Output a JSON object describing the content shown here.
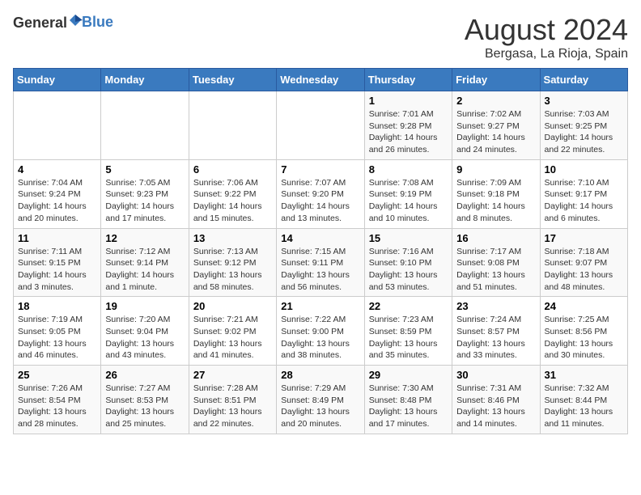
{
  "header": {
    "logo_general": "General",
    "logo_blue": "Blue",
    "month_year": "August 2024",
    "location": "Bergasa, La Rioja, Spain"
  },
  "weekdays": [
    "Sunday",
    "Monday",
    "Tuesday",
    "Wednesday",
    "Thursday",
    "Friday",
    "Saturday"
  ],
  "weeks": [
    [
      {
        "day": "",
        "info": ""
      },
      {
        "day": "",
        "info": ""
      },
      {
        "day": "",
        "info": ""
      },
      {
        "day": "",
        "info": ""
      },
      {
        "day": "1",
        "info": "Sunrise: 7:01 AM\nSunset: 9:28 PM\nDaylight: 14 hours\nand 26 minutes."
      },
      {
        "day": "2",
        "info": "Sunrise: 7:02 AM\nSunset: 9:27 PM\nDaylight: 14 hours\nand 24 minutes."
      },
      {
        "day": "3",
        "info": "Sunrise: 7:03 AM\nSunset: 9:25 PM\nDaylight: 14 hours\nand 22 minutes."
      }
    ],
    [
      {
        "day": "4",
        "info": "Sunrise: 7:04 AM\nSunset: 9:24 PM\nDaylight: 14 hours\nand 20 minutes."
      },
      {
        "day": "5",
        "info": "Sunrise: 7:05 AM\nSunset: 9:23 PM\nDaylight: 14 hours\nand 17 minutes."
      },
      {
        "day": "6",
        "info": "Sunrise: 7:06 AM\nSunset: 9:22 PM\nDaylight: 14 hours\nand 15 minutes."
      },
      {
        "day": "7",
        "info": "Sunrise: 7:07 AM\nSunset: 9:20 PM\nDaylight: 14 hours\nand 13 minutes."
      },
      {
        "day": "8",
        "info": "Sunrise: 7:08 AM\nSunset: 9:19 PM\nDaylight: 14 hours\nand 10 minutes."
      },
      {
        "day": "9",
        "info": "Sunrise: 7:09 AM\nSunset: 9:18 PM\nDaylight: 14 hours\nand 8 minutes."
      },
      {
        "day": "10",
        "info": "Sunrise: 7:10 AM\nSunset: 9:17 PM\nDaylight: 14 hours\nand 6 minutes."
      }
    ],
    [
      {
        "day": "11",
        "info": "Sunrise: 7:11 AM\nSunset: 9:15 PM\nDaylight: 14 hours\nand 3 minutes."
      },
      {
        "day": "12",
        "info": "Sunrise: 7:12 AM\nSunset: 9:14 PM\nDaylight: 14 hours\nand 1 minute."
      },
      {
        "day": "13",
        "info": "Sunrise: 7:13 AM\nSunset: 9:12 PM\nDaylight: 13 hours\nand 58 minutes."
      },
      {
        "day": "14",
        "info": "Sunrise: 7:15 AM\nSunset: 9:11 PM\nDaylight: 13 hours\nand 56 minutes."
      },
      {
        "day": "15",
        "info": "Sunrise: 7:16 AM\nSunset: 9:10 PM\nDaylight: 13 hours\nand 53 minutes."
      },
      {
        "day": "16",
        "info": "Sunrise: 7:17 AM\nSunset: 9:08 PM\nDaylight: 13 hours\nand 51 minutes."
      },
      {
        "day": "17",
        "info": "Sunrise: 7:18 AM\nSunset: 9:07 PM\nDaylight: 13 hours\nand 48 minutes."
      }
    ],
    [
      {
        "day": "18",
        "info": "Sunrise: 7:19 AM\nSunset: 9:05 PM\nDaylight: 13 hours\nand 46 minutes."
      },
      {
        "day": "19",
        "info": "Sunrise: 7:20 AM\nSunset: 9:04 PM\nDaylight: 13 hours\nand 43 minutes."
      },
      {
        "day": "20",
        "info": "Sunrise: 7:21 AM\nSunset: 9:02 PM\nDaylight: 13 hours\nand 41 minutes."
      },
      {
        "day": "21",
        "info": "Sunrise: 7:22 AM\nSunset: 9:00 PM\nDaylight: 13 hours\nand 38 minutes."
      },
      {
        "day": "22",
        "info": "Sunrise: 7:23 AM\nSunset: 8:59 PM\nDaylight: 13 hours\nand 35 minutes."
      },
      {
        "day": "23",
        "info": "Sunrise: 7:24 AM\nSunset: 8:57 PM\nDaylight: 13 hours\nand 33 minutes."
      },
      {
        "day": "24",
        "info": "Sunrise: 7:25 AM\nSunset: 8:56 PM\nDaylight: 13 hours\nand 30 minutes."
      }
    ],
    [
      {
        "day": "25",
        "info": "Sunrise: 7:26 AM\nSunset: 8:54 PM\nDaylight: 13 hours\nand 28 minutes."
      },
      {
        "day": "26",
        "info": "Sunrise: 7:27 AM\nSunset: 8:53 PM\nDaylight: 13 hours\nand 25 minutes."
      },
      {
        "day": "27",
        "info": "Sunrise: 7:28 AM\nSunset: 8:51 PM\nDaylight: 13 hours\nand 22 minutes."
      },
      {
        "day": "28",
        "info": "Sunrise: 7:29 AM\nSunset: 8:49 PM\nDaylight: 13 hours\nand 20 minutes."
      },
      {
        "day": "29",
        "info": "Sunrise: 7:30 AM\nSunset: 8:48 PM\nDaylight: 13 hours\nand 17 minutes."
      },
      {
        "day": "30",
        "info": "Sunrise: 7:31 AM\nSunset: 8:46 PM\nDaylight: 13 hours\nand 14 minutes."
      },
      {
        "day": "31",
        "info": "Sunrise: 7:32 AM\nSunset: 8:44 PM\nDaylight: 13 hours\nand 11 minutes."
      }
    ]
  ]
}
